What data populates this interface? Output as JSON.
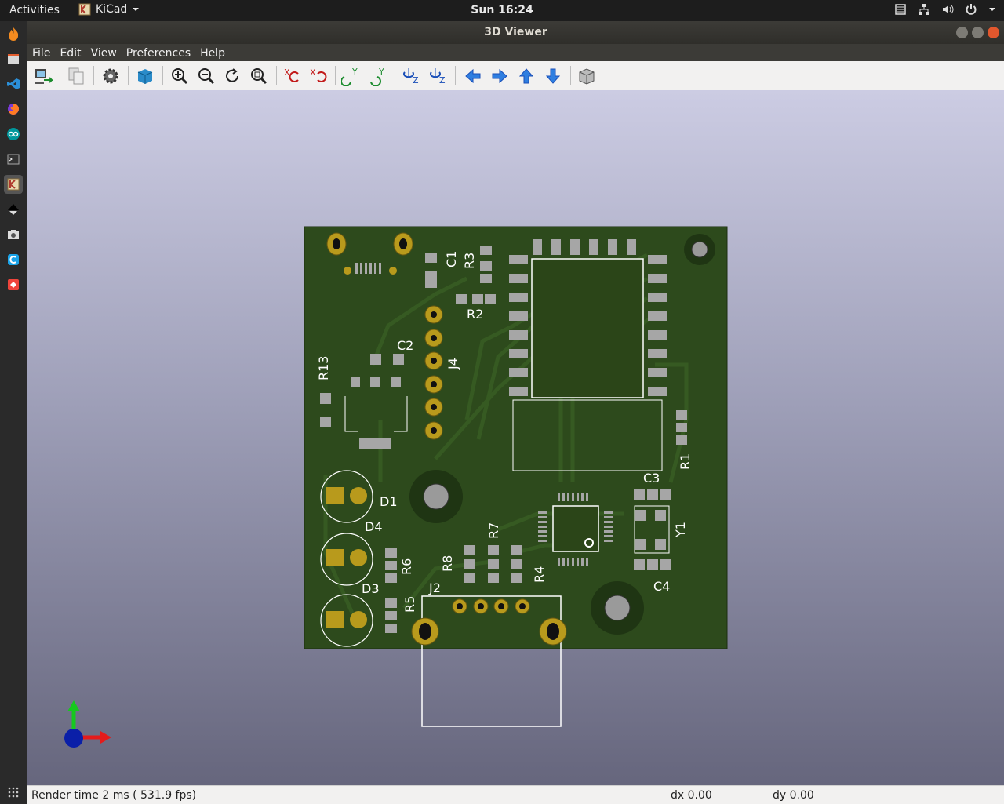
{
  "topbar": {
    "activities": "Activities",
    "app_name": "KiCad",
    "clock": "Sun 16:24"
  },
  "dock": {
    "items": [
      "firefox-flame-icon",
      "file-manager-icon",
      "vscode-icon",
      "firefox-icon",
      "arduino-icon",
      "terminal-icon",
      "kicad-icon",
      "inkscape-icon",
      "screenshot-icon",
      "codeblocks-icon",
      "anydesk-icon"
    ]
  },
  "window": {
    "title": "3D Viewer"
  },
  "menubar": {
    "items": [
      "File",
      "Edit",
      "View",
      "Preferences",
      "Help"
    ]
  },
  "toolbar": {
    "buttons": [
      "reload-board",
      "copy-3d-image",
      "display-options",
      "toggle-render",
      "zoom-in",
      "zoom-out",
      "redraw",
      "zoom-fit",
      "rotate-x-cw",
      "rotate-x-ccw",
      "rotate-y-cw",
      "rotate-y-ccw",
      "rotate-z-cw",
      "rotate-z-ccw",
      "move-left",
      "move-right",
      "move-up",
      "move-down",
      "toggle-orthographic"
    ]
  },
  "pcb": {
    "refdes": [
      "C1",
      "R3",
      "R2",
      "C2",
      "J4",
      "R13",
      "D1",
      "D4",
      "R6",
      "D3",
      "R5",
      "R8",
      "R7",
      "R4",
      "J2",
      "C3",
      "Y1",
      "C4",
      "R1"
    ]
  },
  "statusbar": {
    "render": "Render time 2 ms ( 531.9 fps)",
    "dx": "dx 0.00",
    "dy": "dy 0.00"
  }
}
